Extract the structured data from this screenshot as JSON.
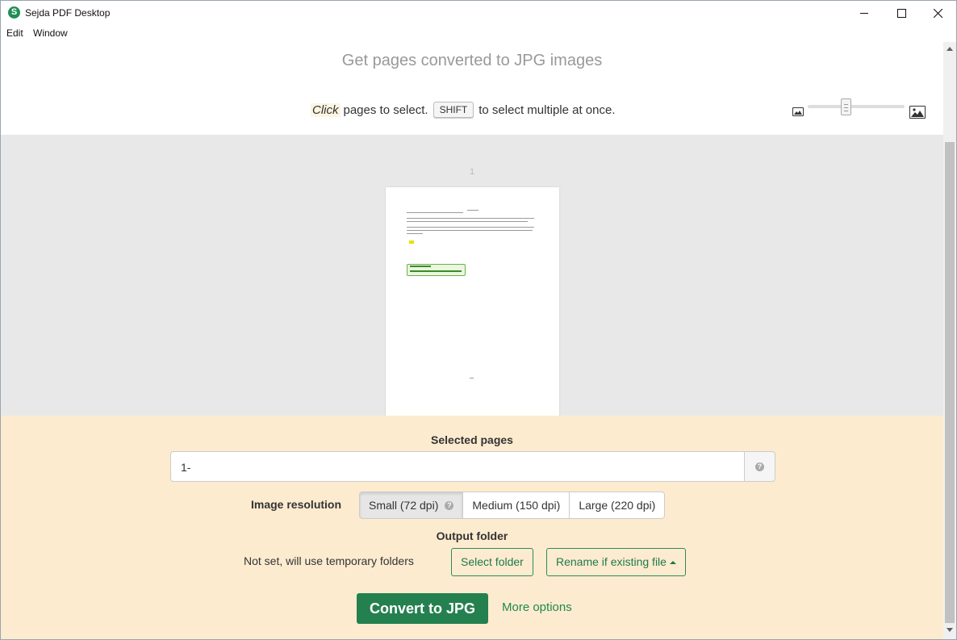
{
  "window": {
    "title": "Sejda PDF Desktop",
    "logo_letter": "S"
  },
  "menu": {
    "items": [
      "Edit",
      "Window"
    ]
  },
  "header": {
    "heading": "Get pages converted to JPG images",
    "hint_click": "Click",
    "hint_mid": "pages to select.",
    "hint_key": "SHIFT",
    "hint_end": "to select multiple at once."
  },
  "preview": {
    "page_number": "1"
  },
  "form": {
    "selected_pages_label": "Selected pages",
    "selected_pages_value": "1-",
    "help_glyph": "?",
    "image_resolution_label": "Image resolution",
    "resolutions": [
      "Small (72 dpi)",
      "Medium (150 dpi)",
      "Large (220 dpi)"
    ],
    "resolution_selected": "Small (72 dpi)",
    "output_folder_label": "Output folder",
    "output_status": "Not set, will use temporary folders",
    "select_folder": "Select folder",
    "rename_option": "Rename if existing file",
    "convert_button": "Convert to JPG",
    "more_options": "More options"
  },
  "colors": {
    "accent": "#25804f",
    "panel_bg": "#fdebd0",
    "preview_bg": "#e8e8e8"
  }
}
